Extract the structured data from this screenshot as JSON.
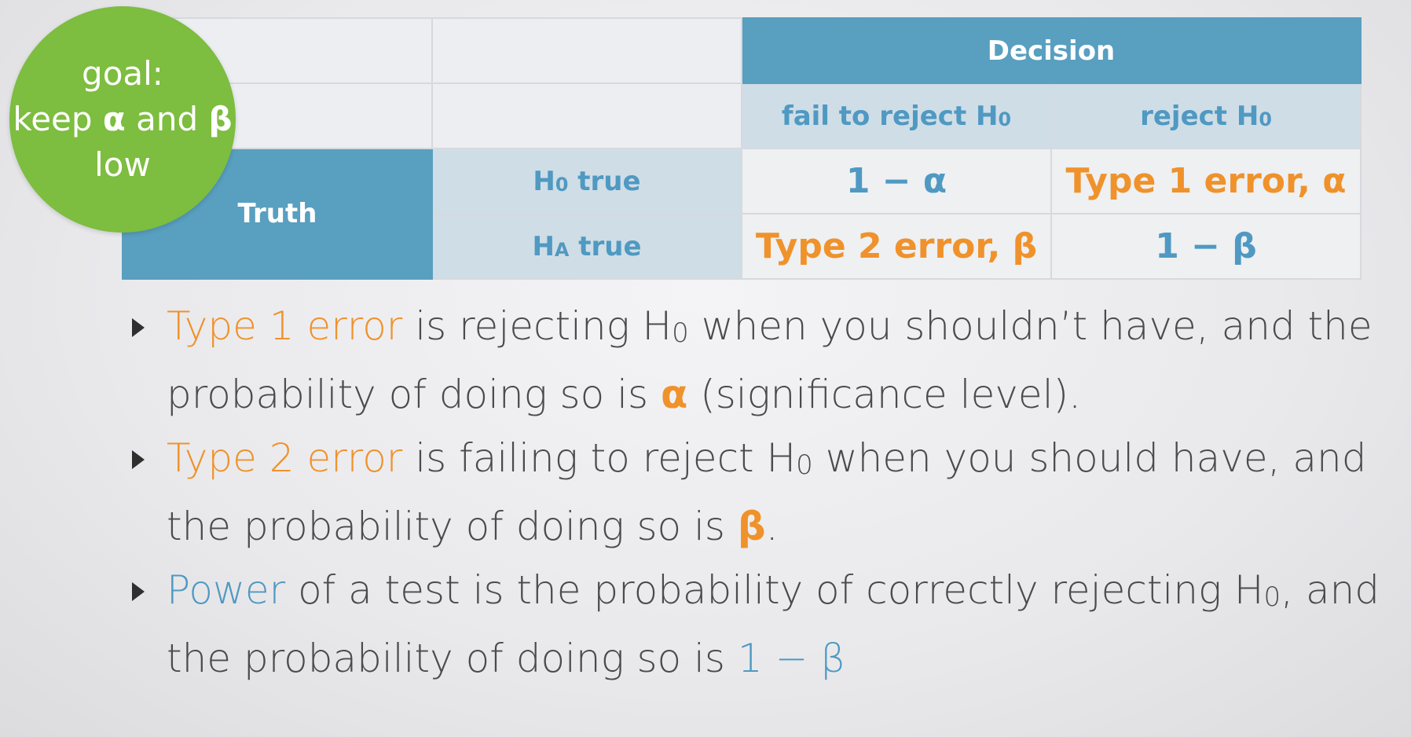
{
  "goal": {
    "line1": "goal:",
    "line2_pre": "keep",
    "alpha": "α",
    "and": "and",
    "beta": "β",
    "line3": "low"
  },
  "table": {
    "decision_header": "Decision",
    "col1_pre": "fail to reject H",
    "col1_sub": "0",
    "col2_pre": "reject H",
    "col2_sub": "0",
    "truth_label": "Truth",
    "row1_pre": "H",
    "row1_sub": "0",
    "row1_post": " true",
    "row2_pre": "H",
    "row2_sub": "A",
    "row2_post": " true",
    "cell_r1c1": "1 − α",
    "cell_r1c2": "Type 1 error, α",
    "cell_r2c1": "Type 2 error, β",
    "cell_r2c2": "1 − β"
  },
  "bullets": [
    {
      "hl": "Type 1 error",
      "t1": " is rejecting H",
      "sub": "0",
      "t2": " when you shouldn’t have, and the probability of doing so is ",
      "sym": "α",
      "t3": " (significance level)."
    },
    {
      "hl": "Type 2 error",
      "t1": " is failing to reject H",
      "sub": "0",
      "t2": " when you should have, and the probability of doing so is ",
      "sym": "β",
      "t3": "."
    },
    {
      "hl": "Power",
      "t1": " of a test is the probability of correctly rejecting H",
      "sub": "0",
      "t2": ", and the probability of doing so is ",
      "sym": "1 − β",
      "t3": ""
    }
  ],
  "colors": {
    "header_blue": "#589fc0",
    "light_blue": "#cfdde6",
    "text_blue": "#4f99c2",
    "orange": "#ef922b",
    "green": "#7dbd3f"
  }
}
